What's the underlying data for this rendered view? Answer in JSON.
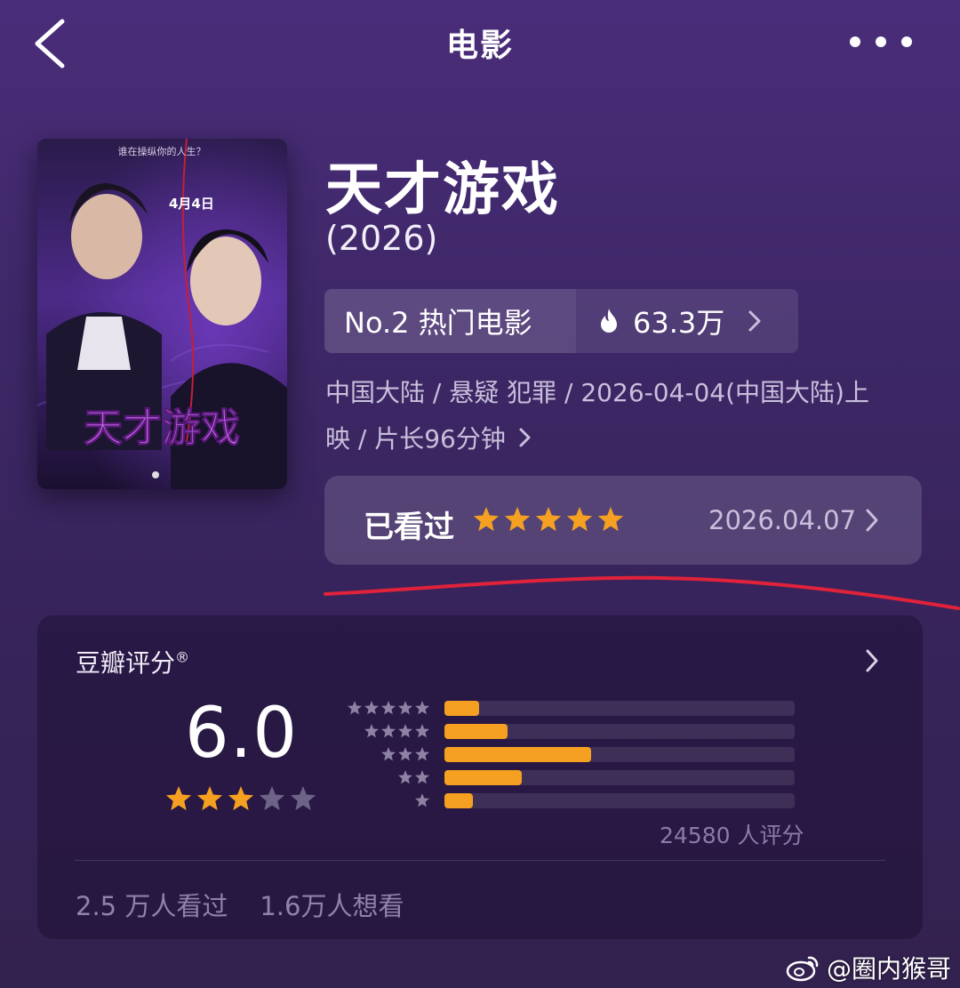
{
  "header": {
    "title": "电影"
  },
  "poster": {
    "tagline": "谁在操纵你的人生？",
    "release_note": "4月4日",
    "title_art": "天才游戏"
  },
  "movie": {
    "title": "天才游戏",
    "year": "(2026)",
    "rank_label": "No.2 热门电影",
    "heat": "63.3万",
    "meta_line1": "中国大陆 / 悬疑 犯罪 / 2026-04-04(中国大陆)上",
    "meta_line2": "映 / 片长96分钟"
  },
  "watched": {
    "label": "已看过",
    "stars": 5,
    "date": "2026.04.07"
  },
  "rating": {
    "title": "豆瓣评分",
    "mark": "®",
    "score": "6.0",
    "stars_filled": 3,
    "distribution": [
      {
        "stars": 5,
        "fraction": 0.1
      },
      {
        "stars": 4,
        "fraction": 0.18
      },
      {
        "stars": 3,
        "fraction": 0.42
      },
      {
        "stars": 2,
        "fraction": 0.22
      },
      {
        "stars": 1,
        "fraction": 0.08
      }
    ],
    "count_text": "24580 人评分",
    "watched_count": "2.5 万人看过",
    "want_count": "1.6万人想看"
  },
  "watermark": "@圈内猴哥",
  "colors": {
    "star": "#f5a021",
    "star_empty": "#6f6288",
    "dist_star": "#8d82a3",
    "red_mark": "#e0223a"
  },
  "icons": [
    "back-arrow-icon",
    "more-dots-icon",
    "flame-icon",
    "chevron-right-icon",
    "star-icon",
    "weibo-icon"
  ]
}
